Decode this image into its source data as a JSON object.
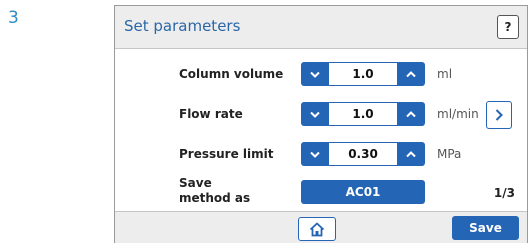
{
  "step_number": "3",
  "dialog": {
    "title": "Set parameters",
    "help_label": "?"
  },
  "parameters": [
    {
      "label": "Column volume",
      "value": "1.0",
      "unit": "ml"
    },
    {
      "label": "Flow rate",
      "value": "1.0",
      "unit": "ml/min"
    },
    {
      "label": "Pressure limit",
      "value": "0.30",
      "unit": "MPa"
    }
  ],
  "save_method": {
    "label_line1": "Save",
    "label_line2": "method as",
    "value": "AC01"
  },
  "page_indicator": "1/3",
  "footer": {
    "save_label": "Save"
  },
  "icons": {
    "decrement": "chevron-down-icon",
    "increment": "chevron-up-icon",
    "next": "chevron-right-icon",
    "home": "home-icon"
  },
  "colors": {
    "accent": "#2565b5",
    "title": "#2a66a8",
    "step": "#2d8cc4"
  }
}
